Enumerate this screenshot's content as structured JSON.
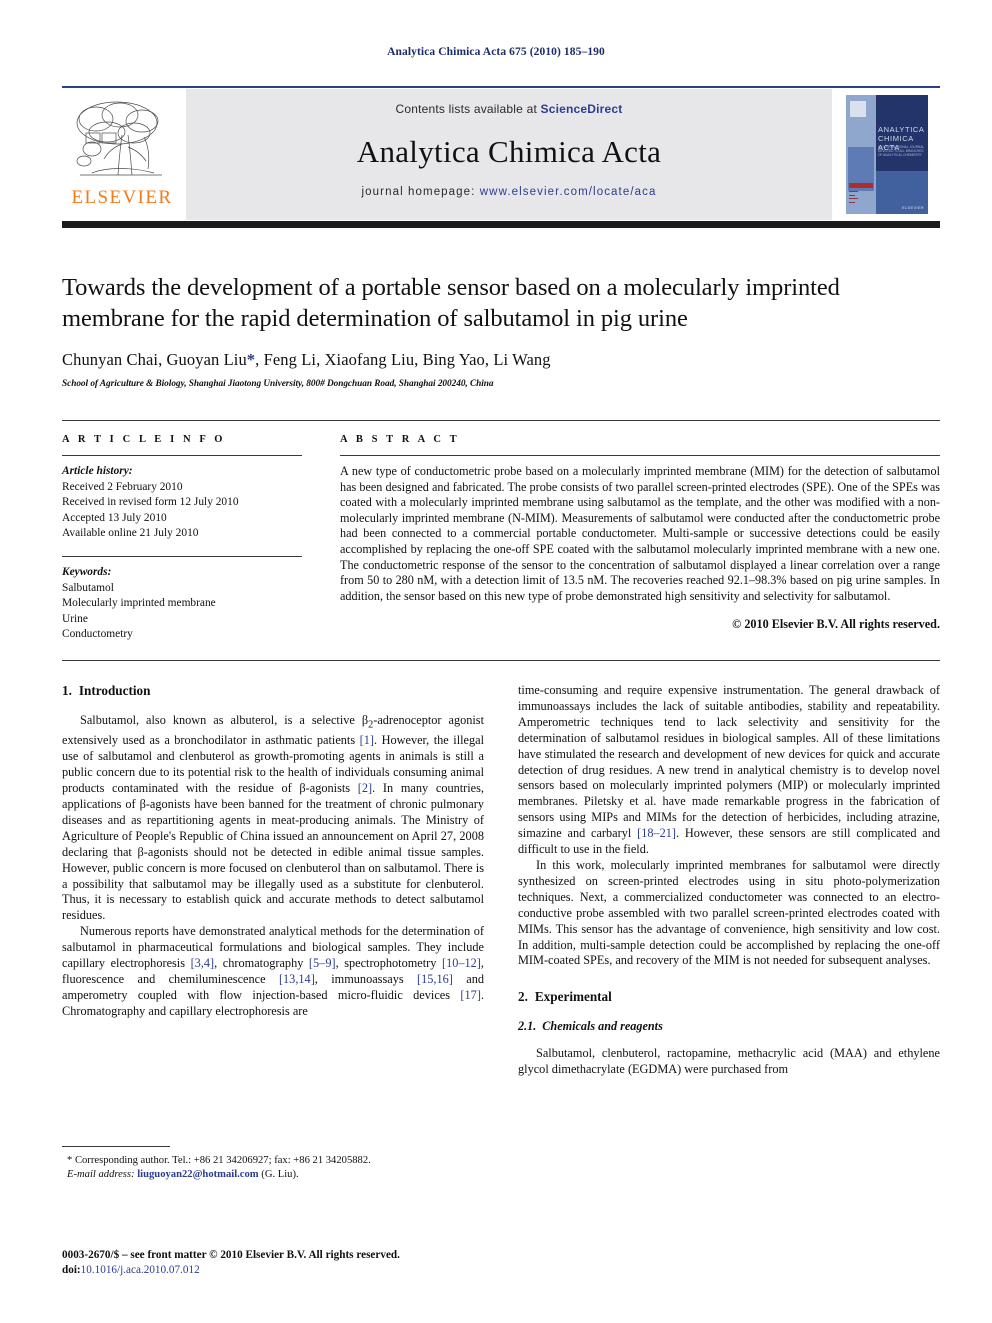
{
  "running_head": "Analytica Chimica Acta 675 (2010) 185–190",
  "masthead": {
    "contents_prefix": "Contents lists available at ",
    "sciencedirect": "ScienceDirect",
    "journal_title": "Analytica Chimica Acta",
    "homepage_prefix": "journal homepage: ",
    "homepage_url": "www.elsevier.com/locate/aca",
    "publisher_wordmark": "ELSEVIER",
    "cover_title_line1": "ANALYTICA",
    "cover_title_line2": "CHIMICA ACTA",
    "cover_subtitle": "AN INTERNATIONAL JOURNAL DEVOTED TO ALL BRANCHES OF ANALYTICAL CHEMISTRY",
    "cover_brand": "ELSEVIER"
  },
  "title_block": {
    "title": "Towards the development of a portable sensor based on a molecularly imprinted membrane for the rapid determination of salbutamol in pig urine",
    "authors_before_star": "Chunyan Chai, Guoyan Liu",
    "corresponding_marker": "*",
    "authors_after_star": ", Feng Li, Xiaofang Liu, Bing Yao, Li Wang",
    "affiliation": "School of Agriculture & Biology, Shanghai Jiaotong University, 800# Dongchuan Road, Shanghai 200240, China"
  },
  "article_info": {
    "heading": "A R T I C L E  I N F O",
    "history_label": "Article history:",
    "history": [
      "Received 2 February 2010",
      "Received in revised form 12 July 2010",
      "Accepted 13 July 2010",
      "Available online 21 July 2010"
    ],
    "keywords_label": "Keywords:",
    "keywords": [
      "Salbutamol",
      "Molecularly imprinted membrane",
      "Urine",
      "Conductometry"
    ]
  },
  "abstract": {
    "heading": "A B S T R A C T",
    "text": "A new type of conductometric probe based on a molecularly imprinted membrane (MIM) for the detection of salbutamol has been designed and fabricated. The probe consists of two parallel screen-printed electrodes (SPE). One of the SPEs was coated with a molecularly imprinted membrane using salbutamol as the template, and the other was modified with a non-molecularly imprinted membrane (N-MIM). Measurements of salbutamol were conducted after the conductometric probe had been connected to a commercial portable conductometer. Multi-sample or successive detections could be easily accomplished by replacing the one-off SPE coated with the salbutamol molecularly imprinted membrane with a new one. The conductometric response of the sensor to the concentration of salbutamol displayed a linear correlation over a range from 50 to 280 nM, with a detection limit of 13.5 nM. The recoveries reached 92.1–98.3% based on pig urine samples. In addition, the sensor based on this new type of probe demonstrated high sensitivity and selectivity for salbutamol.",
    "copyright": "© 2010 Elsevier B.V. All rights reserved."
  },
  "body": {
    "section1": {
      "number": "1.",
      "title": "Introduction",
      "para1_a": "Salbutamol, also known as albuterol, is a selective β",
      "para1_sub": "2",
      "para1_b": "-adrenoceptor agonist extensively used as a bronchodilator in asthmatic patients ",
      "para1_cite1": "[1]",
      "para1_c": ". However, the illegal use of salbutamol and clenbuterol as growth-promoting agents in animals is still a public concern due to its potential risk to the health of individuals consuming animal products contaminated with the residue of β-agonists ",
      "para1_cite2": "[2]",
      "para1_d": ". In many countries, applications of β-agonists have been banned for the treatment of chronic pulmonary diseases and as repartitioning agents in meat-producing animals. The Ministry of Agriculture of People's Republic of China issued an announcement on April 27, 2008 declaring that β-agonists should not be detected in edible animal tissue samples. However, public concern is more focused on clenbuterol than on salbutamol. There is a possibility that salbutamol may be illegally used as a substitute for clenbuterol. Thus, it is necessary to establish quick and accurate methods to detect salbutamol residues.",
      "para2_a": "Numerous reports have demonstrated analytical methods for the determination of salbutamol in pharmaceutical formulations and biological samples. They include capillary electrophoresis ",
      "para2_cite1": "[3,4]",
      "para2_b": ", chromatography ",
      "para2_cite2": "[5–9]",
      "para2_c": ", spectrophotometry ",
      "para2_cite3": "[10–12]",
      "para2_d": ", fluorescence and chemiluminescence ",
      "para2_cite4": "[13,14]",
      "para2_e": ", immunoassays ",
      "para2_cite5": "[15,16]",
      "para2_f": " and amperometry coupled with flow injection-based micro-fluidic devices ",
      "para2_cite6": "[17]",
      "para2_g": ". Chromatography and capillary electrophoresis are",
      "para3_a": "time-consuming and require expensive instrumentation. The general drawback of immunoassays includes the lack of suitable antibodies, stability and repeatability. Amperometric techniques tend to lack selectivity and sensitivity for the determination of salbutamol residues in biological samples. All of these limitations have stimulated the research and development of new devices for quick and accurate detection of drug residues. A new trend in analytical chemistry is to develop novel sensors based on molecularly imprinted polymers (MIP) or molecularly imprinted membranes. Piletsky et al. have made remarkable progress in the fabrication of sensors using MIPs and MIMs for the detection of herbicides, including atrazine, simazine and carbaryl ",
      "para3_cite1": "[18–21]",
      "para3_b": ". However, these sensors are still complicated and difficult to use in the field.",
      "para4": "In this work, molecularly imprinted membranes for salbutamol were directly synthesized on screen-printed electrodes using in situ photo-polymerization techniques. Next, a commercialized conductometer was connected to an electro-conductive probe assembled with two parallel screen-printed electrodes coated with MIMs. This sensor has the advantage of convenience, high sensitivity and low cost. In addition, multi-sample detection could be accomplished by replacing the one-off MIM-coated SPEs, and recovery of the MIM is not needed for subsequent analyses."
    },
    "section2": {
      "number": "2.",
      "title": "Experimental",
      "subsection_number": "2.1.",
      "subsection_title": "Chemicals and reagents",
      "para1": "Salbutamol, clenbuterol, ractopamine, methacrylic acid (MAA) and ethylene glycol dimethacrylate (EGDMA) were purchased from"
    }
  },
  "footnote": {
    "corresponding": "* Corresponding author. Tel.: +86 21 34206927; fax: +86 21 34205882.",
    "email_label": "E-mail address:",
    "email": "liuguoyan22@hotmail.com",
    "email_suffix": "(G. Liu)."
  },
  "imprint": {
    "line1": "0003-2670/$ – see front matter © 2010 Elsevier B.V. All rights reserved.",
    "doi_label": "doi:",
    "doi_value": "10.1016/j.aca.2010.07.012"
  }
}
